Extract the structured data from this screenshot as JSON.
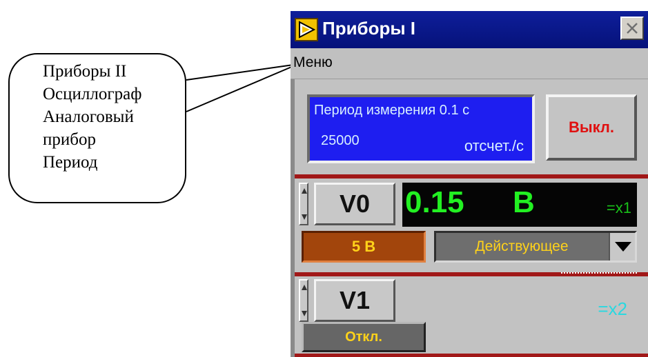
{
  "callout": {
    "lines": [
      "Приборы II",
      "Осциллограф",
      "Аналоговый",
      "прибор",
      "Период"
    ]
  },
  "window": {
    "title": "Приборы I",
    "menu_label": "Меню"
  },
  "info_panel": {
    "period_text": "Период измерения 0.1 с",
    "rate_value": "25000",
    "rate_unit": "отсчет./с"
  },
  "off_button_label": "Выкл.",
  "channel0": {
    "name": "V0",
    "value": "0.15",
    "unit": "В",
    "multiplier": "=x1",
    "range": "5 В",
    "mode": "Действующее"
  },
  "channel1": {
    "name": "V1",
    "multiplier": "=x2",
    "state_label": "Откл."
  },
  "colors": {
    "titlebar": "#0a1a8a",
    "info_panel_bg": "#1e1ef0",
    "readout_bg": "#050505",
    "readout_text": "#22f022",
    "off_text": "#e01010",
    "range_bg": "#a2450c",
    "accent_yellow": "#ffd21a",
    "divider_red": "#a11818",
    "multiplier2": "#2ad8e0"
  },
  "icons": {
    "app": "labview-run-icon",
    "close": "close-icon",
    "dropdown": "triangle-down-icon",
    "spinner": "spinner-icon"
  }
}
